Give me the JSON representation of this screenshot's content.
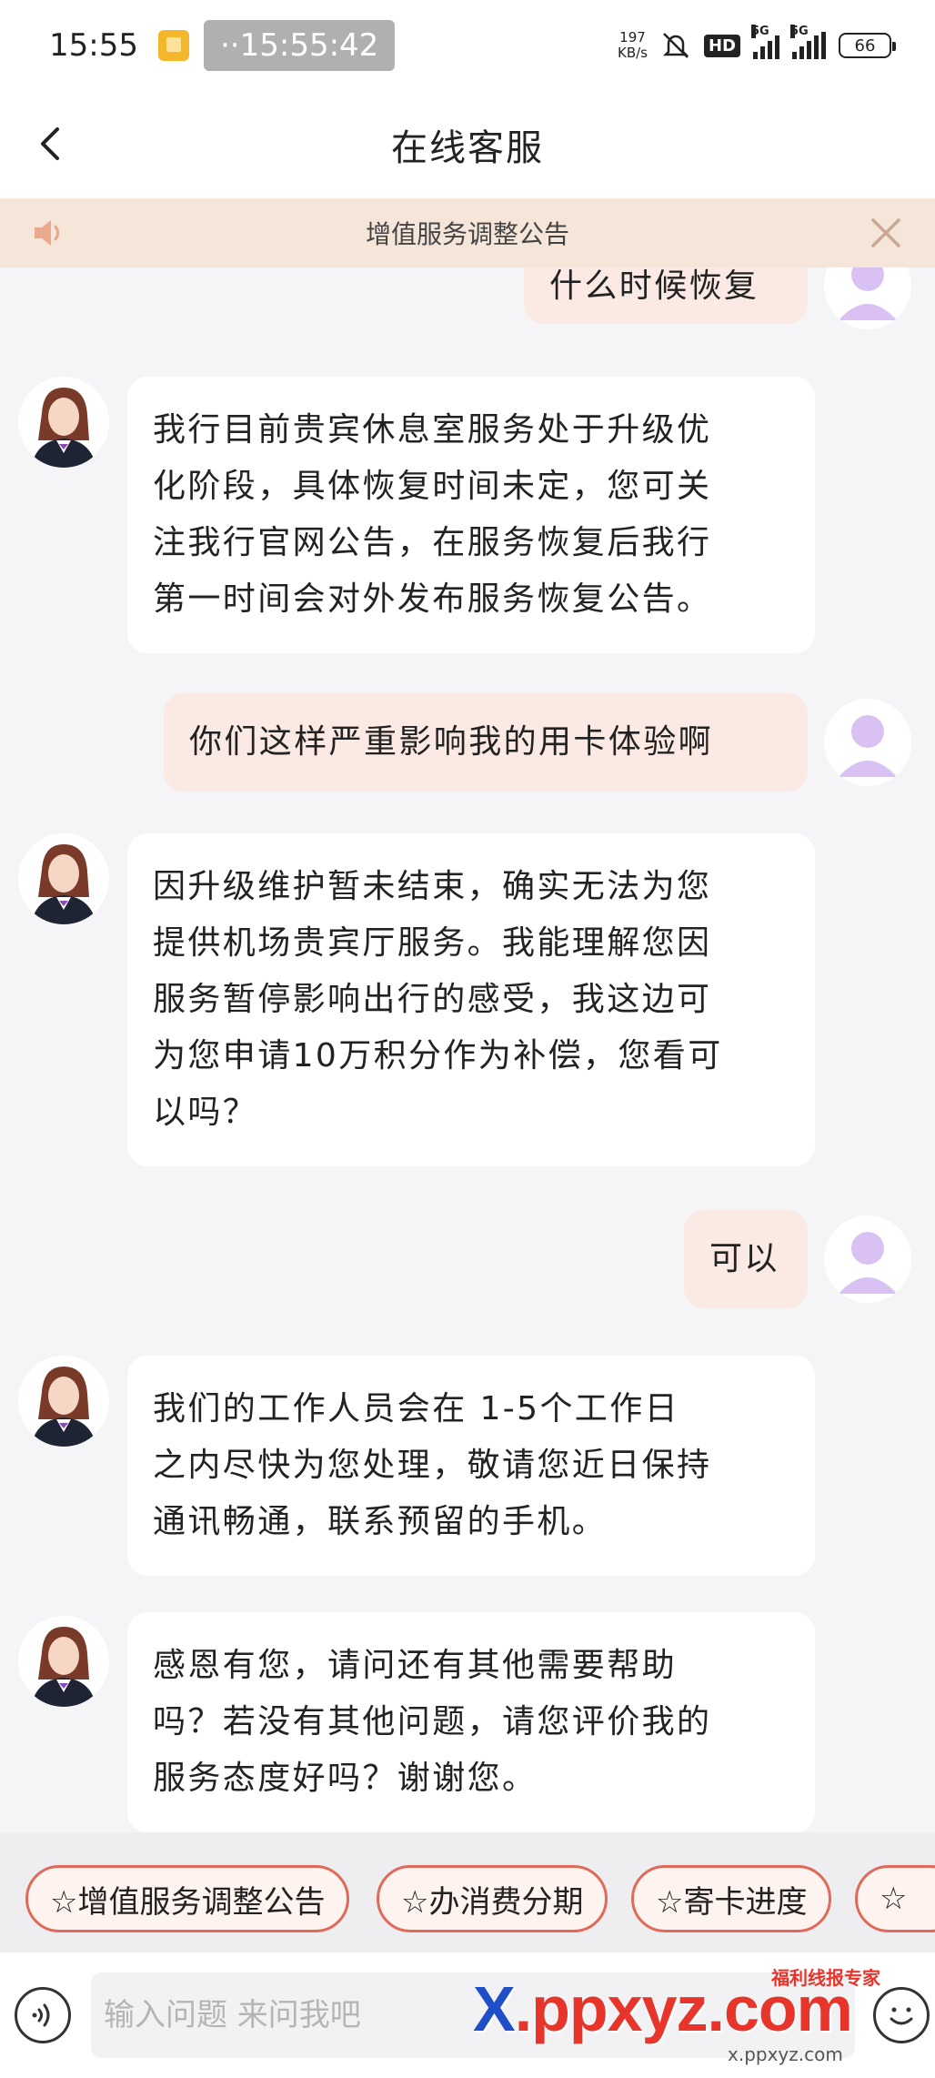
{
  "status_bar": {
    "time": "15:55",
    "recording_time": "15:55:42",
    "net_speed_value": "197",
    "net_speed_unit": "KB/s",
    "hd_label": "HD",
    "signal_label_1": "5G",
    "signal_label_2": "5G",
    "battery": "66"
  },
  "nav": {
    "title": "在线客服"
  },
  "notice": {
    "text": "增值服务调整公告"
  },
  "messages": [
    {
      "role": "user",
      "text": "什么时候恢复"
    },
    {
      "role": "agent",
      "lines": [
        "我行目前贵宾休息室服务处于升级优",
        "化阶段，具体恢复时间未定，您可关",
        "注我行官网公告，在服务恢复后我行",
        "第一时间会对外发布服务恢复公告。"
      ]
    },
    {
      "role": "user",
      "text": "你们这样严重影响我的用卡体验啊"
    },
    {
      "role": "agent",
      "lines": [
        "因升级维护暂未结束，确实无法为您",
        "提供机场贵宾厅服务。我能理解您因",
        "服务暂停影响出行的感受，我这边可",
        "为您申请10万积分作为补偿，您看可",
        "以吗？"
      ]
    },
    {
      "role": "user",
      "text": "可以"
    },
    {
      "role": "agent",
      "lines": [
        "我们的工作人员会在 1-5个工作日",
        "之内尽快为您处理，敬请您近日保持",
        "通讯畅通，联系预留的手机。"
      ]
    },
    {
      "role": "agent",
      "lines": [
        "感恩有您，请问还有其他需要帮助",
        "吗？若没有其他问题，请您评价我的",
        "服务态度好吗？谢谢您。"
      ]
    }
  ],
  "quick_replies": [
    "☆增值服务调整公告",
    "☆办消费分期",
    "☆寄卡进度",
    "☆"
  ],
  "input": {
    "placeholder": "输入问题 来问我吧"
  },
  "watermark": {
    "main_x": "X",
    "main_rest": ".ppxyz.com",
    "tag": "福利线报专家",
    "url": "x.ppxyz.com"
  },
  "colors": {
    "user_bubble": "#fbe9e3",
    "agent_bubble": "#ffffff",
    "notice_bg": "#f6e6da",
    "chip_border": "#e06a5a",
    "watermark_red": "#e8352c",
    "watermark_blue": "#1f4fc8"
  }
}
